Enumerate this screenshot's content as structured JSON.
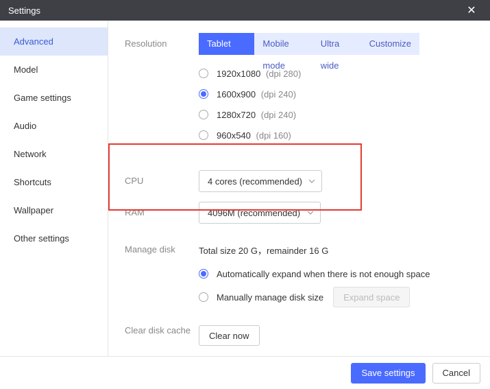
{
  "titlebar": {
    "title": "Settings"
  },
  "sidebar": {
    "items": [
      {
        "label": "Advanced",
        "active": true
      },
      {
        "label": "Model"
      },
      {
        "label": "Game settings"
      },
      {
        "label": "Audio"
      },
      {
        "label": "Network"
      },
      {
        "label": "Shortcuts"
      },
      {
        "label": "Wallpaper"
      },
      {
        "label": "Other settings"
      }
    ]
  },
  "sections": {
    "resolution": {
      "label": "Resolution",
      "tabs": [
        {
          "label": "Tablet mode",
          "active": true
        },
        {
          "label": "Mobile mode"
        },
        {
          "label": "Ultra wide"
        },
        {
          "label": "Customize"
        }
      ],
      "options": [
        {
          "res": "1920x1080",
          "dpi": "(dpi 280)",
          "selected": false
        },
        {
          "res": "1600x900",
          "dpi": "(dpi 240)",
          "selected": true
        },
        {
          "res": "1280x720",
          "dpi": "(dpi 240)",
          "selected": false
        },
        {
          "res": "960x540",
          "dpi": "(dpi 160)",
          "selected": false
        }
      ]
    },
    "cpu": {
      "label": "CPU",
      "value": "4 cores (recommended)"
    },
    "ram": {
      "label": "RAM",
      "value": "4096M (recommended)"
    },
    "disk": {
      "label": "Manage disk",
      "total": "Total size 20 G，remainder 16 G",
      "auto": {
        "label": "Automatically expand when there is not enough space",
        "selected": true
      },
      "manual": {
        "label": "Manually manage disk size",
        "selected": false
      },
      "expand_btn": "Expand space"
    },
    "clear": {
      "label": "Clear disk cache",
      "button": "Clear now"
    }
  },
  "footer": {
    "save": "Save settings",
    "cancel": "Cancel"
  }
}
